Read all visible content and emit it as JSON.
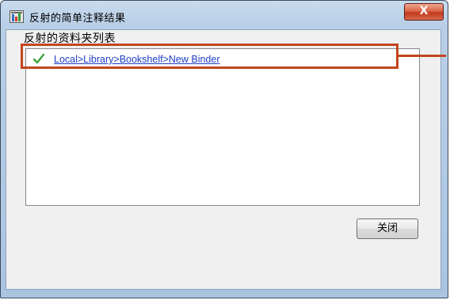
{
  "window": {
    "title": "反射的简单注释结果",
    "close_glyph": "X"
  },
  "main": {
    "section_label": "反射的资料夹列表",
    "list": {
      "items": [
        {
          "status_icon": "check-icon",
          "path": "Local>Library>Bookshelf>New Binder"
        }
      ]
    }
  },
  "footer": {
    "close_label": "关闭"
  },
  "colors": {
    "callout": "#c2461e",
    "link": "#1f3fc4",
    "check": "#3aa33a",
    "title_close": "#c2381b"
  }
}
